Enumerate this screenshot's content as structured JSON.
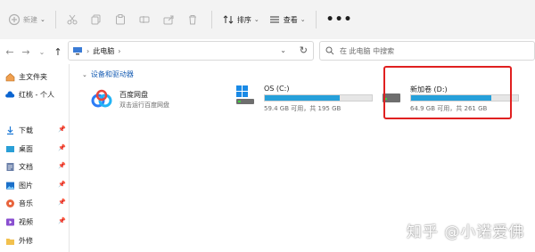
{
  "toolbar": {
    "new_label": "新建",
    "sort_label": "排序",
    "view_label": "查看",
    "more_label": "•••"
  },
  "address": {
    "path_label": "此电脑",
    "search_placeholder": "在 此电脑 中搜索"
  },
  "sidebar": {
    "items": [
      {
        "label": "主文件夹",
        "icon": "home-icon"
      },
      {
        "label": "红桃 - 个人",
        "icon": "onedrive-icon"
      },
      {
        "label": "下载",
        "icon": "download-icon",
        "pinned": true
      },
      {
        "label": "桌面",
        "icon": "desktop-icon",
        "pinned": true
      },
      {
        "label": "文档",
        "icon": "document-icon",
        "pinned": true
      },
      {
        "label": "图片",
        "icon": "picture-icon",
        "pinned": true
      },
      {
        "label": "音乐",
        "icon": "music-icon",
        "pinned": true
      },
      {
        "label": "视频",
        "icon": "video-icon",
        "pinned": true
      },
      {
        "label": "外修",
        "icon": "folder-icon",
        "pinned": false
      }
    ]
  },
  "content": {
    "group_header": "设备和驱动器",
    "apps": [
      {
        "name": "百度网盘",
        "subtitle": "双击运行百度网盘"
      }
    ],
    "drives": [
      {
        "name": "OS (C:)",
        "info": "59.4 GB 可用，共 195 GB",
        "used_fraction": 0.7
      },
      {
        "name": "新加卷 (D:)",
        "info": "64.9 GB 可用，共 261 GB",
        "used_fraction": 0.75
      }
    ]
  },
  "watermark": "知乎 @小诺爱佛",
  "colors": {
    "accent": "#26a0da",
    "highlight": "#e02020",
    "link": "#1a5fb4"
  }
}
